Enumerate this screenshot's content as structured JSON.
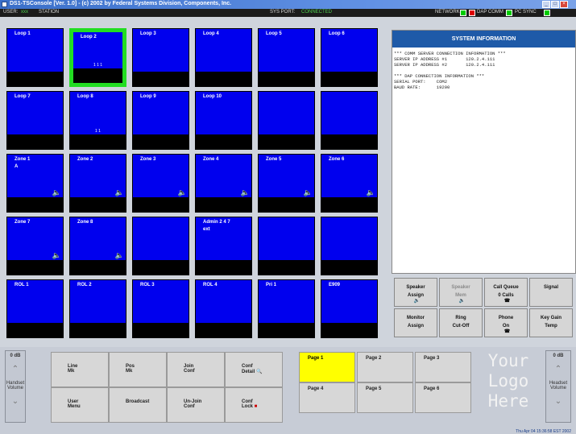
{
  "window": {
    "title": "DS1-TSConsole [Ver. 1.0] - (c) 2002 by Federal Systems Division, Components, Inc.",
    "controls": [
      "_",
      "□",
      "×"
    ]
  },
  "status": {
    "user_label": "USER:",
    "user_value": "xxx",
    "station_label": "STATION",
    "sys_port_label": "SYS PORT:",
    "sys_port_value": "CONNECTED",
    "network_label": "NETWORK",
    "dap_comm_label": "DAP COMM",
    "pc_sync_label": "PC SYNC",
    "indicator_colors": {
      "network": "#00cc00",
      "dap": "#dd0000",
      "pc": "#00cc00"
    }
  },
  "tiles": [
    {
      "label": "Loop 1"
    },
    {
      "label": "Loop 2",
      "selected": true,
      "overlay": "1 1 1"
    },
    {
      "label": "Loop 3"
    },
    {
      "label": "Loop 4"
    },
    {
      "label": "Loop 5"
    },
    {
      "label": "Loop 6"
    },
    {
      "label": "Loop 7"
    },
    {
      "label": "Loop 8",
      "overlay": "1 1"
    },
    {
      "label": "Loop 9"
    },
    {
      "label": "Loop 10"
    },
    {
      "label": ""
    },
    {
      "label": ""
    },
    {
      "label": "Zone 1",
      "label2": "A",
      "speaker": true
    },
    {
      "label": "Zone 2",
      "speaker": true
    },
    {
      "label": "Zone 3",
      "speaker": true
    },
    {
      "label": "Zone 4",
      "speaker": true
    },
    {
      "label": "Zone 5",
      "speaker": true
    },
    {
      "label": "Zone 6",
      "speaker": true
    },
    {
      "label": "Zone 7",
      "speaker": true
    },
    {
      "label": "Zone 8",
      "speaker": true
    },
    {
      "label": ""
    },
    {
      "label": "Admin 2 4 7",
      "label2": "ext"
    },
    {
      "label": ""
    },
    {
      "label": ""
    },
    {
      "label": "ROL 1"
    },
    {
      "label": "ROL 2"
    },
    {
      "label": "ROL 3"
    },
    {
      "label": "ROL 4"
    },
    {
      "label": "Pri 1"
    },
    {
      "label": "E909"
    }
  ],
  "system_info": {
    "header": "SYSTEM INFORMATION",
    "lines": [
      "*** COMM SERVER CONNECTION INFORMATION ***",
      "SERVER IP ADDRESS #1       120.2.4.111",
      "SERVER IP ADDRESS #2       120.2.4.111",
      "",
      "*** DAP CONNECTION INFORMATION ***",
      "SERIAL PORT:    COM2",
      "BAUD RATE:      19200"
    ]
  },
  "controls": [
    {
      "line1": "Speaker",
      "line2": "Assign",
      "icon": "🔈"
    },
    {
      "line1": "Speaker",
      "line2": "Mem",
      "icon": "🔈",
      "disabled": true
    },
    {
      "line1": "Call Queue",
      "line2": "0 Calls",
      "icon": "☎"
    },
    {
      "line1": "Signal",
      "line2": ""
    },
    {
      "line1": "Monitor",
      "line2": "Assign"
    },
    {
      "line1": "Ring",
      "line2": "Cut-Off"
    },
    {
      "line1": "Phone",
      "line2": "On",
      "icon": "☎"
    },
    {
      "line1": "Key Gain",
      "line2": "Temp"
    }
  ],
  "commands": [
    {
      "line1": "Line",
      "line2": "Mk"
    },
    {
      "line1": "Pos",
      "line2": "Mk"
    },
    {
      "line1": "Join",
      "line2": "Conf"
    },
    {
      "line1": "Conf",
      "line2": "Detail",
      "icon": "🔍"
    },
    {
      "line1": "User",
      "line2": "Menu"
    },
    {
      "line1": "Broadcast",
      "line2": ""
    },
    {
      "line1": "Un-Join",
      "line2": "Conf"
    },
    {
      "line1": "Conf",
      "line2": "Lock",
      "icon": "■"
    }
  ],
  "pages": [
    "Page 1",
    "Page 2",
    "Page 3",
    "Page 4",
    "Page 5",
    "Page 6"
  ],
  "active_page": "Page 1",
  "volume_left": {
    "label": "0 dB",
    "caption1": "Handset",
    "caption2": "Volume"
  },
  "volume_right": {
    "label": "0 dB",
    "caption1": "Headset",
    "caption2": "Volume"
  },
  "logo": {
    "line1": "Your",
    "line2": "Logo",
    "line3": "Here"
  },
  "clock": "Thu Apr 04 15:36:58 EST 2002"
}
